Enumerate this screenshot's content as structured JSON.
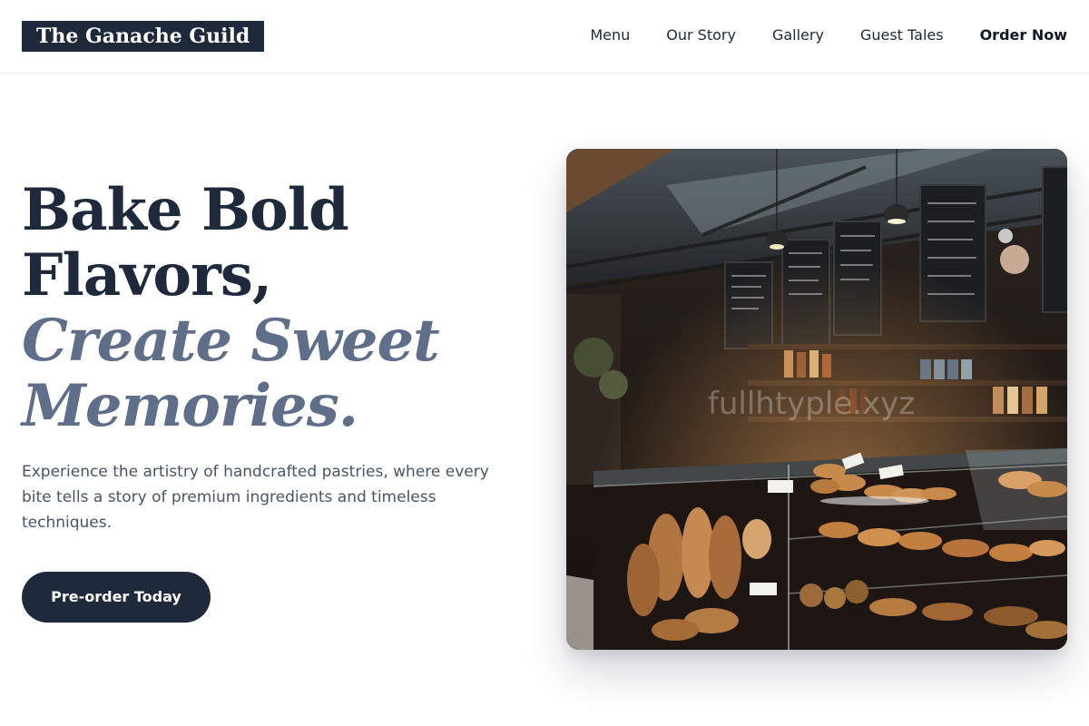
{
  "brand": {
    "name": "The Ganache Guild"
  },
  "nav": {
    "items": [
      {
        "label": "Menu"
      },
      {
        "label": "Our Story"
      },
      {
        "label": "Gallery"
      },
      {
        "label": "Guest Tales"
      }
    ],
    "cta_label": "Order Now"
  },
  "hero": {
    "headline_line1": "Bake Bold",
    "headline_line2": "Flavors,",
    "headline_accent_line1": "Create Sweet",
    "headline_accent_line2": "Memories.",
    "subtitle": "Experience the artistry of handcrafted pastries, where every bite tells a story of premium ingredients and timeless techniques.",
    "button_label": "Pre-order Today",
    "image_watermark": "fullhtyple.xyz"
  },
  "colors": {
    "primary": "#1e293b",
    "accent_text": "#5f6f8a",
    "body_text": "#475569"
  }
}
